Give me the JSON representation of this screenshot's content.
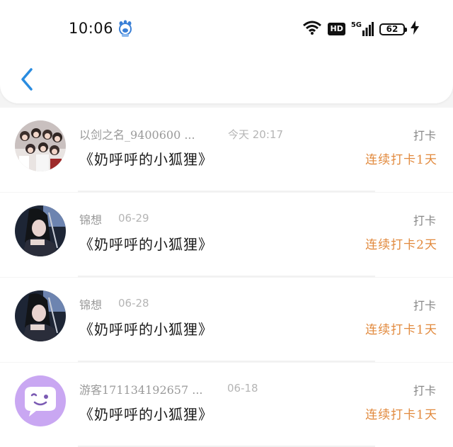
{
  "status_bar": {
    "time": "10:06",
    "hd": "HD",
    "network": "5G",
    "battery": "62"
  },
  "colors": {
    "accent": "#2a8ce0",
    "streak": "#e28a3e",
    "guest_avatar": "#c9a7f2"
  },
  "entries": [
    {
      "name": "以剑之名_9400600 ...",
      "time": "今天 20:17",
      "title": "《奶呼呼的小狐狸》",
      "action": "打卡",
      "streak": "连续打卡1天"
    },
    {
      "name": "锦想",
      "time": "06-29",
      "title": "《奶呼呼的小狐狸》",
      "action": "打卡",
      "streak": "连续打卡2天"
    },
    {
      "name": "锦想",
      "time": "06-28",
      "title": "《奶呼呼的小狐狸》",
      "action": "打卡",
      "streak": "连续打卡1天"
    },
    {
      "name": "游客171134192657 ...",
      "time": "06-18",
      "title": "《奶呼呼的小狐狸》",
      "action": "打卡",
      "streak": "连续打卡1天"
    }
  ]
}
